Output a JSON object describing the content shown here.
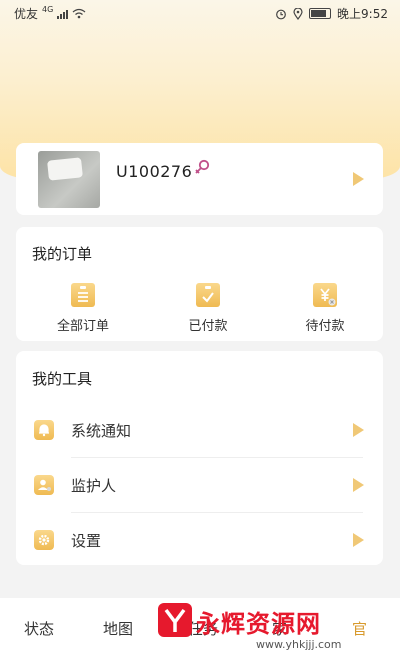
{
  "status_bar": {
    "carrier": "优友",
    "network": "4G",
    "time": "晚上9:52"
  },
  "profile": {
    "user_id": "U100276",
    "gender_icon": "female-icon"
  },
  "orders": {
    "title": "我的订单",
    "items": [
      {
        "label": "全部订单",
        "icon": "order-list-icon"
      },
      {
        "label": "已付款",
        "icon": "paid-clipboard-icon"
      },
      {
        "label": "待付款",
        "icon": "pending-payment-icon"
      }
    ]
  },
  "tools": {
    "title": "我的工具",
    "items": [
      {
        "label": "系统通知",
        "icon": "bell-icon"
      },
      {
        "label": "监护人",
        "icon": "guardian-icon"
      },
      {
        "label": "设置",
        "icon": "gear-icon"
      }
    ]
  },
  "tab_bar": {
    "tabs": [
      "状态",
      "地图",
      "任务",
      "家",
      "官"
    ]
  },
  "watermark": {
    "text": "永辉资源网",
    "url": "www.yhkjjj.com"
  },
  "colors": {
    "accent": "#efba52",
    "arrow": "#f0c876",
    "gender": "#c0508a",
    "watermark": "#e6192d"
  }
}
